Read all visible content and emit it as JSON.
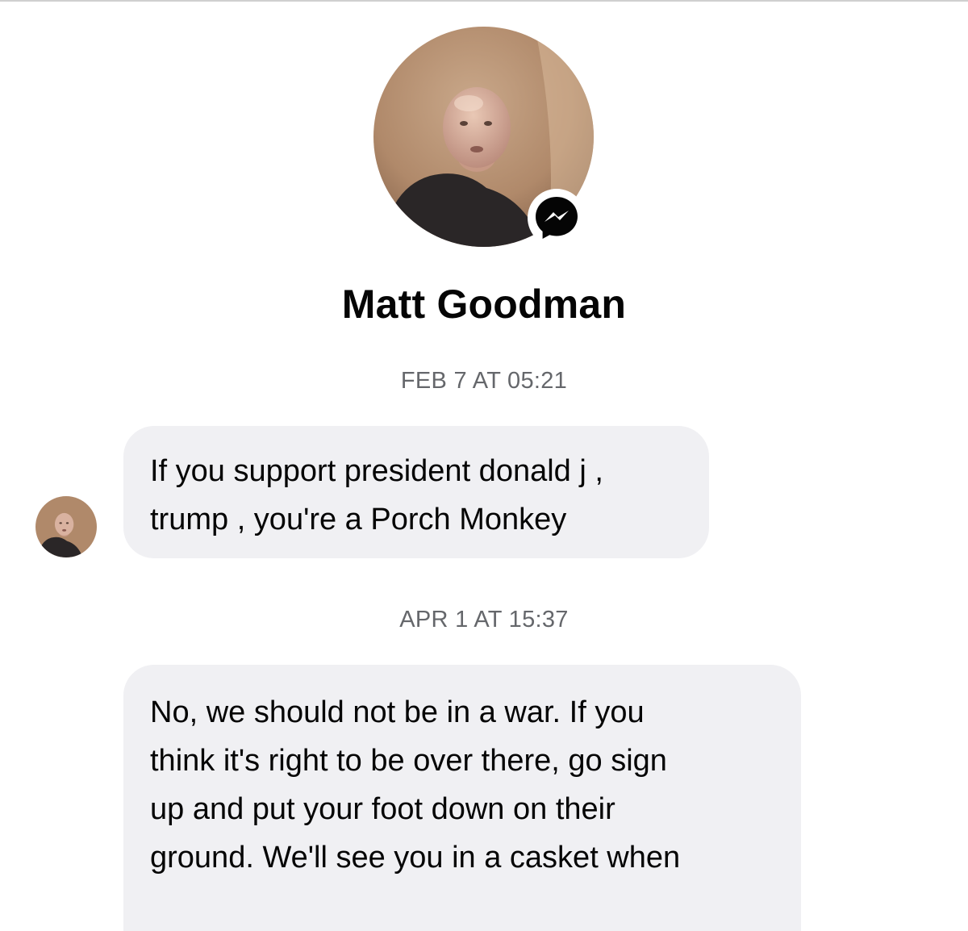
{
  "contact": {
    "name": "Matt Goodman"
  },
  "icons": {
    "profile_badge": "messenger-icon",
    "profile_photo": "avatar-photo",
    "sender_photo": "avatar-photo"
  },
  "colors": {
    "bubble_bg": "#f0f0f3",
    "timestamp_text": "#65676b",
    "name_text": "#050505",
    "badge_bg": "#050505"
  },
  "messages": [
    {
      "timestamp": "FEB 7 AT 05:21",
      "lines": [
        "If you support president donald j ,",
        "trump , you're a Porch Monkey"
      ]
    },
    {
      "timestamp": "APR 1 AT 15:37",
      "lines": [
        "No, we should not be in a war. If you",
        "think it's right to be over there, go sign",
        "up and put your foot down on their",
        "ground. We'll see you in a casket when"
      ]
    }
  ]
}
